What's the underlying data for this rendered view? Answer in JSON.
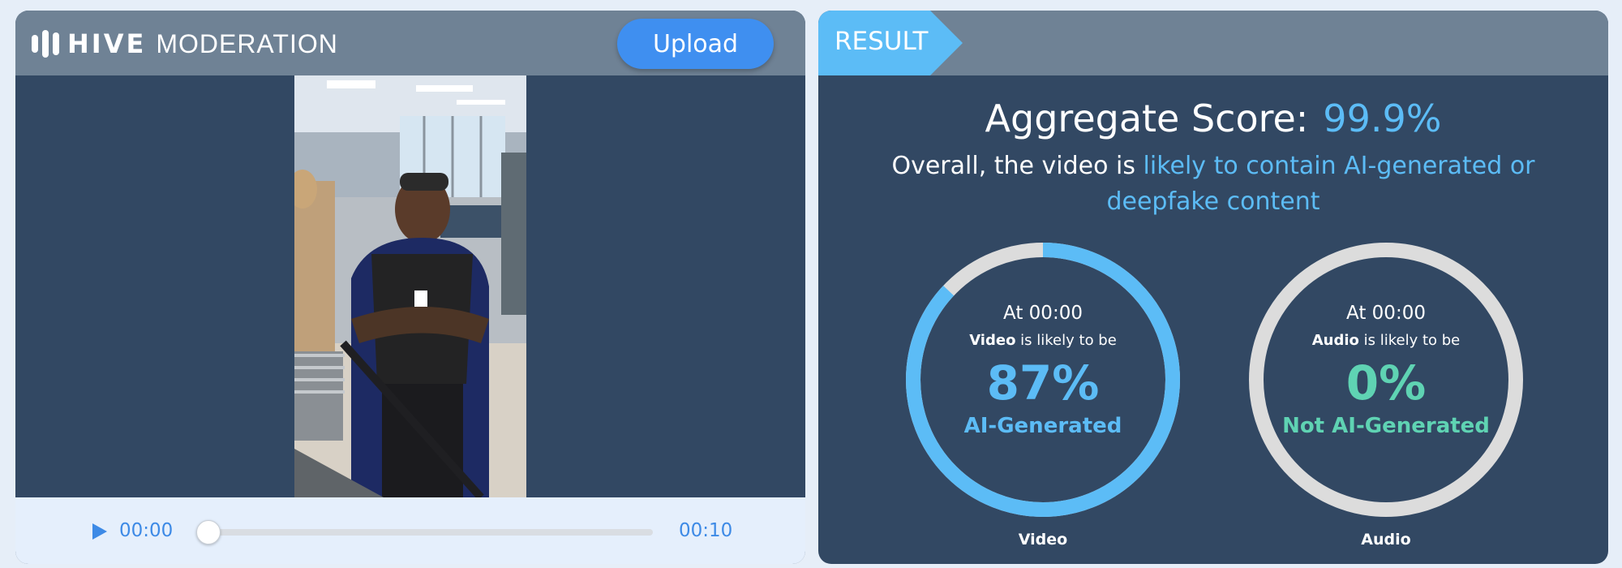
{
  "left": {
    "logo": {
      "brand": "HIVE",
      "product": "MODERATION"
    },
    "upload_label": "Upload",
    "player": {
      "current_time": "00:00",
      "total_time": "00:10",
      "progress": 0
    }
  },
  "right": {
    "result_label": "RESULT",
    "aggregate_label": "Aggregate Score:",
    "aggregate_score": "99.9%",
    "summary_prefix": "Overall, the video is",
    "summary_highlight": "likely to contain AI-generated or deepfake content",
    "gauges": [
      {
        "at": "At 00:00",
        "subject": "Video",
        "likely": "is likely to be",
        "percent": "87%",
        "value": 0.87,
        "verdict": "AI-Generated",
        "color": "#5cbcf6",
        "caption": "Video"
      },
      {
        "at": "At 00:00",
        "subject": "Audio",
        "likely": "is likely to be",
        "percent": "0%",
        "value": 0,
        "verdict": "Not AI-Generated",
        "color": "#5fd3b3",
        "caption": "Audio"
      }
    ]
  },
  "colors": {
    "panel": "#324863",
    "header": "#6f8295",
    "accent_blue": "#5cbcf6",
    "accent_green": "#5fd3b3",
    "button": "#3f8ff0",
    "ring_track": "#dcdcdc"
  }
}
